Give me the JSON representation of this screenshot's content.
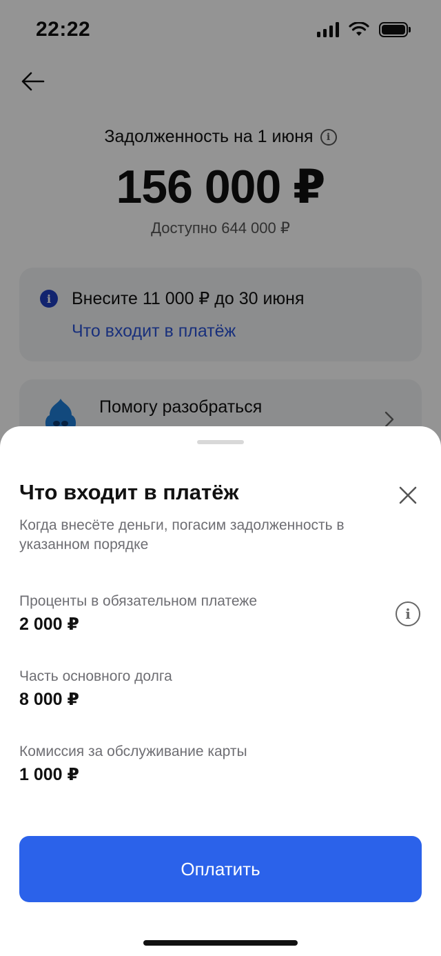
{
  "status_bar": {
    "time": "22:22",
    "icons": [
      "cellular-signal-icon",
      "wifi-icon",
      "battery-icon"
    ]
  },
  "background_screen": {
    "back_icon": "arrow-left-icon",
    "debt_title": "Задолженность на 1 июня",
    "debt_amount": "156 000 ₽",
    "available": "Доступно 644 000 ₽",
    "payment_card": {
      "text": "Внесите 11 000 ₽ до 30 июня",
      "link": "Что входит в платёж"
    },
    "help_card": {
      "text": "Помогу разобраться"
    }
  },
  "sheet": {
    "title": "Что входит в платёж",
    "subtitle": "Когда внесёте деньги, погасим задолженность в указанном порядке",
    "items": [
      {
        "label": "Проценты в обязательном платеже",
        "value": "2 000 ₽",
        "has_info": true
      },
      {
        "label": "Часть основного долга",
        "value": "8 000 ₽",
        "has_info": false
      },
      {
        "label": "Комиссия за обслуживание карты",
        "value": "1 000 ₽",
        "has_info": false
      }
    ],
    "pay_button": "Оплатить"
  },
  "colors": {
    "accent": "#2b62ea",
    "link": "#2b54d6",
    "info_badge": "#1f3fbf",
    "overlay": "rgba(0,0,0,0.42)"
  }
}
